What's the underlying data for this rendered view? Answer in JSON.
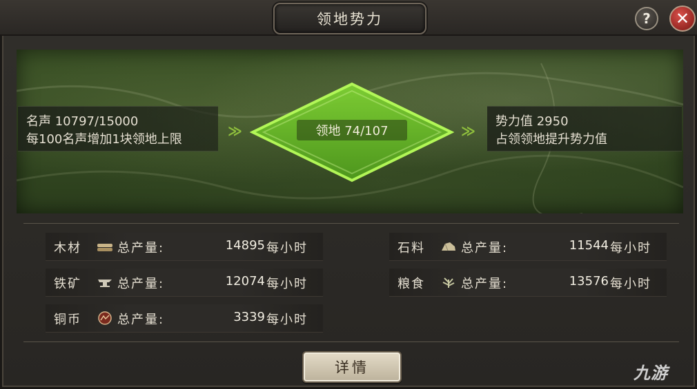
{
  "title": "领地势力",
  "help_label": "?",
  "close_label": "✕",
  "reputation": {
    "line1": "名声 10797/15000",
    "line2": "每100名声增加1块领地上限"
  },
  "territory": {
    "label": "领地 74/107"
  },
  "power": {
    "line1": "势力值 2950",
    "line2": "占领领地提升势力值"
  },
  "arrow_glyph": "≫",
  "resources_left": [
    {
      "name": "木材",
      "icon": "wood-icon",
      "label": "总产量:",
      "value": "14895",
      "unit": "每小时"
    },
    {
      "name": "铁矿",
      "icon": "anvil-icon",
      "label": "总产量:",
      "value": "12074",
      "unit": "每小时"
    },
    {
      "name": "铜币",
      "icon": "coin-icon",
      "label": "总产量:",
      "value": "3339",
      "unit": "每小时"
    }
  ],
  "resources_right": [
    {
      "name": "石料",
      "icon": "stone-icon",
      "label": "总产量:",
      "value": "11544",
      "unit": "每小时"
    },
    {
      "name": "粮食",
      "icon": "grain-icon",
      "label": "总产量:",
      "value": "13576",
      "unit": "每小时"
    }
  ],
  "detail_button": "详情",
  "watermark": "九游",
  "colors": {
    "diamond_fill": "#6fbf2a",
    "diamond_glow": "#a6ff3a",
    "close_red": "#c43a33"
  }
}
